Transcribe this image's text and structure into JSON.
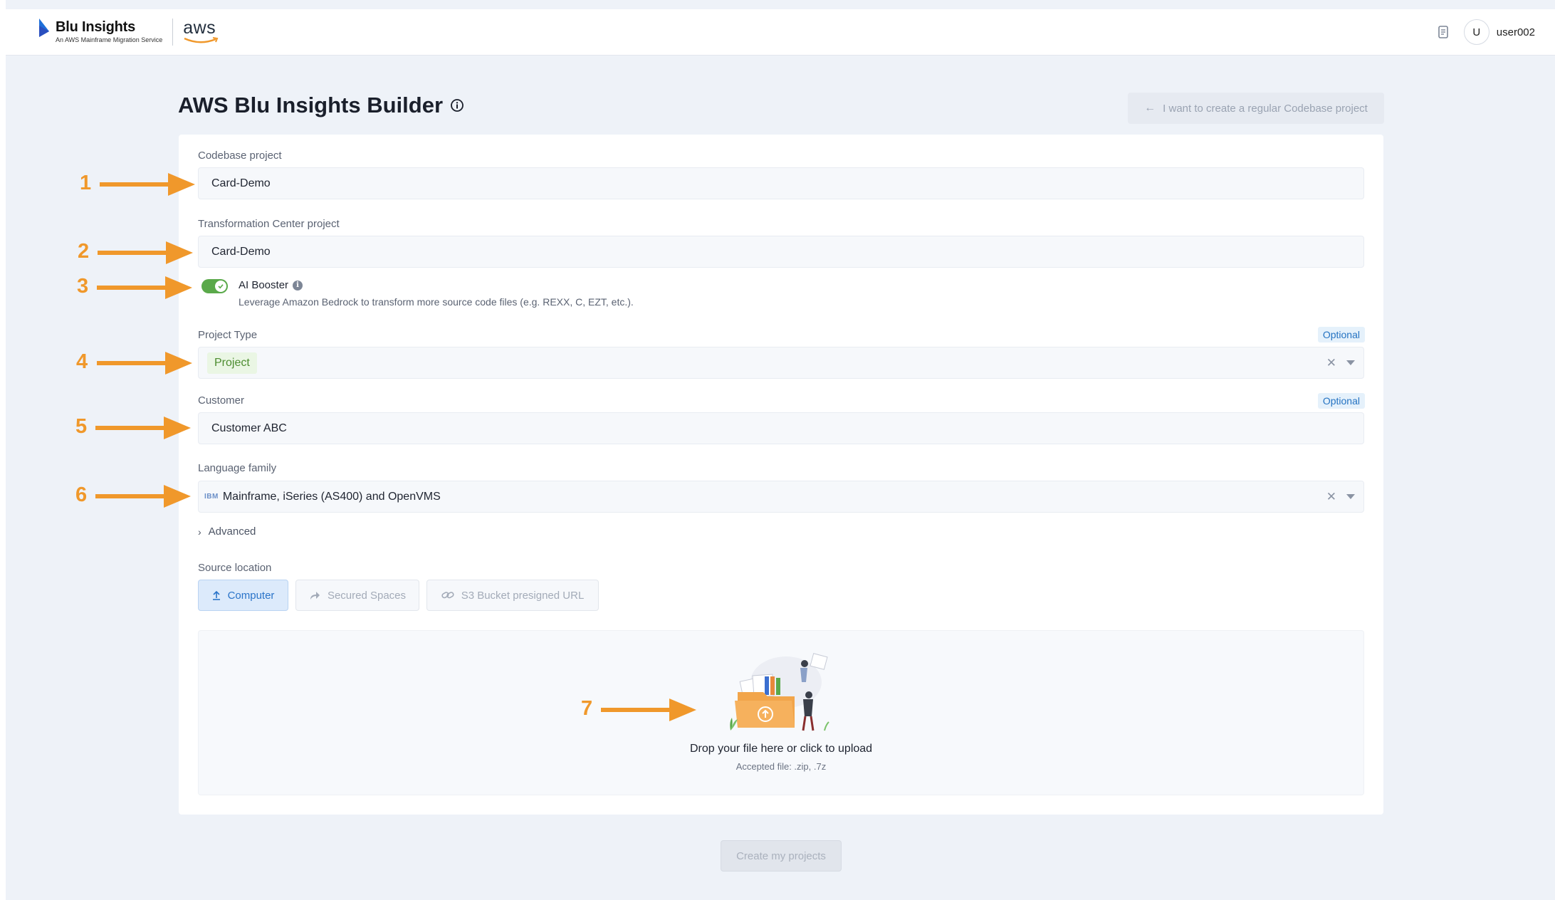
{
  "header": {
    "brand_name": "Blu Insights",
    "brand_sub": "An AWS Mainframe Migration Service",
    "aws_logo": "aws",
    "avatar_initial": "U",
    "username": "user002",
    "icons": [
      "document-icon"
    ]
  },
  "page": {
    "title": "AWS Blu Insights Builder",
    "regular_project_button": "I want to create a regular Codebase project"
  },
  "form": {
    "codebase_label": "Codebase project",
    "codebase_value": "Card-Demo",
    "transformation_label": "Transformation Center project",
    "transformation_value": "Card-Demo",
    "ai_booster_label": "AI Booster",
    "ai_booster_enabled": true,
    "ai_booster_desc": "Leverage Amazon Bedrock to transform more source code files (e.g. REXX, C, EZT, etc.).",
    "project_type_label": "Project Type",
    "project_type_optional": "Optional",
    "project_type_value": "Project",
    "customer_label": "Customer",
    "customer_optional": "Optional",
    "customer_value": "Customer ABC",
    "language_label": "Language family",
    "language_logo": "IBM",
    "language_value": "Mainframe, iSeries (AS400) and OpenVMS",
    "advanced_label": "Advanced",
    "source_label": "Source location",
    "source_tabs": [
      {
        "label": "Computer",
        "active": true
      },
      {
        "label": "Secured Spaces",
        "active": false
      },
      {
        "label": "S3 Bucket presigned URL",
        "active": false
      }
    ],
    "drop_main": "Drop your file here or click to upload",
    "drop_sub": "Accepted file: .zip, .7z",
    "create_button": "Create my projects"
  },
  "annotations": [
    "1",
    "2",
    "3",
    "4",
    "5",
    "6",
    "7"
  ],
  "colors": {
    "accent_orange": "#f0982b",
    "toggle_green": "#5aa94a",
    "active_tab_blue": "#2a74c9"
  }
}
